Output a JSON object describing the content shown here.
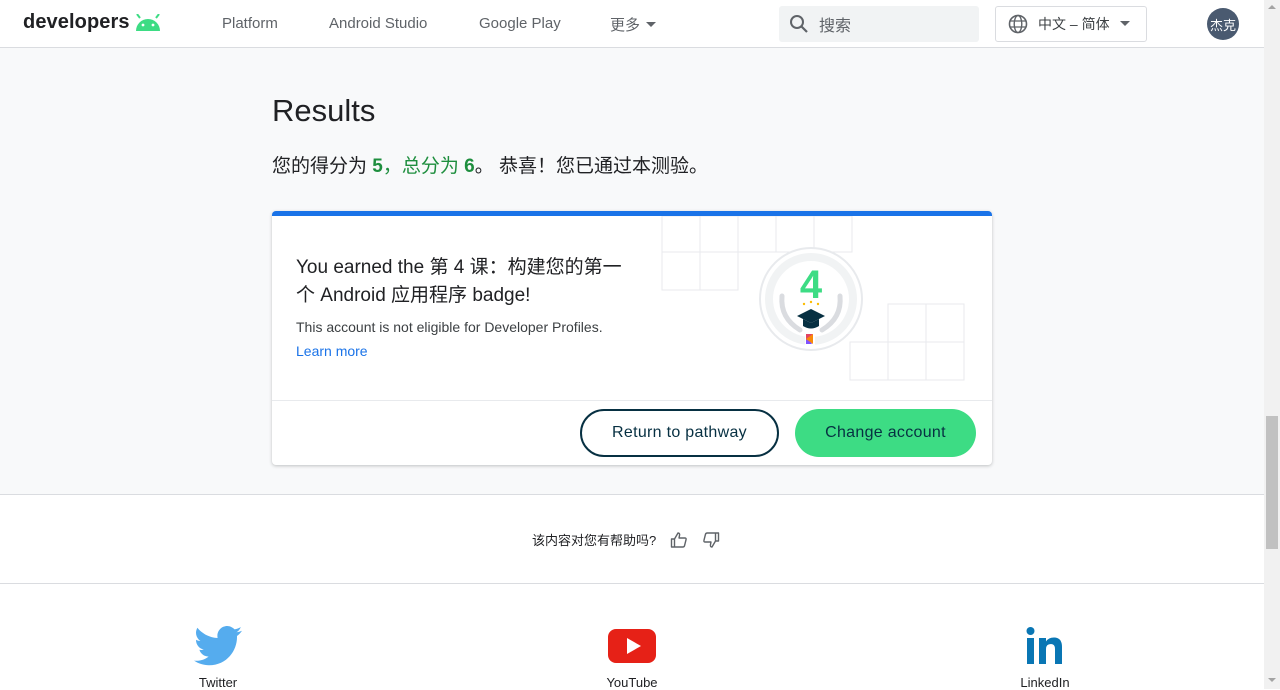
{
  "header": {
    "logo_text": "developers",
    "nav": [
      "Platform",
      "Android Studio",
      "Google Play"
    ],
    "more_label": "更多",
    "search_placeholder": "搜索",
    "language": "中文 – 简体",
    "avatar_initials": "杰克"
  },
  "results": {
    "title": "Results",
    "score_prefix": "您的得分为 ",
    "score": "5",
    "total_prefix": "，总分为 ",
    "total": "6",
    "congrats": "。 恭喜！您已通过本测验。"
  },
  "card": {
    "accent_color": "#1a73e8",
    "earned_prefix": "You earned the ",
    "badge_name": "第 4 课：构建您的第一个 Android 应用程序",
    "earned_suffix": " badge!",
    "eligibility": "This account is not eligible for Developer Profiles.",
    "learn_more": "Learn more",
    "badge_number": "4",
    "return_button": "Return to pathway",
    "change_button": "Change account",
    "change_button_color": "#3ddc84"
  },
  "feedback": {
    "question": "该内容对您有帮助吗?",
    "thumbs_up_icon": "thumbs-up-icon",
    "thumbs_down_icon": "thumbs-down-icon"
  },
  "social": [
    {
      "label": "Twitter",
      "icon": "twitter-icon"
    },
    {
      "label": "YouTube",
      "icon": "youtube-icon"
    },
    {
      "label": "LinkedIn",
      "icon": "linkedin-icon"
    }
  ]
}
